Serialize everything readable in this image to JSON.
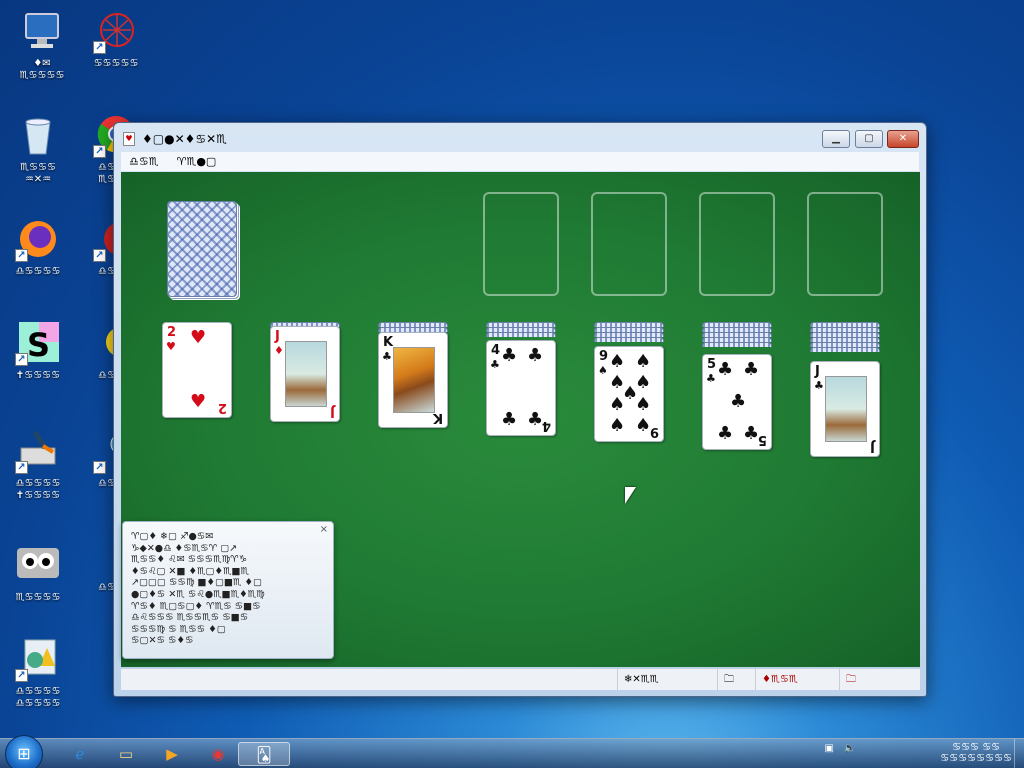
{
  "desktop": {
    "icons": [
      {
        "label": "♦✉\n♏♋♋♋♋",
        "icon": "computer-icon"
      },
      {
        "label": "♋♋♋♋♋",
        "icon": "network-icon"
      },
      {
        "label": "♏♋♋♋\n♒✕♒",
        "icon": "recycle-bin-icon"
      },
      {
        "label": "♎♋♋♋\n♏♋♋♋",
        "icon": "chrome-icon"
      },
      {
        "label": "♎♋♋♋♋",
        "icon": "firefox-icon"
      },
      {
        "label": "♎♋♋♋",
        "icon": "app-icon"
      },
      {
        "label": "✝♋♋♋♋",
        "icon": "s-app-icon"
      },
      {
        "label": "♎♋♋♋",
        "icon": "emoji-app-icon"
      },
      {
        "label": "♎♋♋♋♋\n✝♋♋♋♋",
        "icon": "cleaner-icon"
      },
      {
        "label": "♎♋♋♋",
        "icon": "globe-app-icon"
      },
      {
        "label": "♏♋♋♋♋",
        "icon": "eyes-app-icon"
      },
      {
        "label": "♎♋♋♋",
        "icon": "folder-icon"
      },
      {
        "label": "♎♋♋♋♋\n♎♋♋♋♋",
        "icon": "settings-app-icon"
      }
    ]
  },
  "window": {
    "title": "♦▢●✕♦♋✕♏",
    "controls": {
      "minimize": "▁",
      "maximize": "▢",
      "close": "✕"
    },
    "menu": [
      "♎♋♏",
      "♈♏●▢"
    ]
  },
  "game": {
    "tableau": [
      {
        "rank": "2",
        "suit": "♥",
        "color": "red"
      },
      {
        "rank": "J",
        "suit": "♦",
        "color": "red"
      },
      {
        "rank": "K",
        "suit": "♣",
        "color": "blk"
      },
      {
        "rank": "4",
        "suit": "♣",
        "color": "blk"
      },
      {
        "rank": "9",
        "suit": "♠",
        "color": "blk"
      },
      {
        "rank": "5",
        "suit": "♣",
        "color": "blk"
      },
      {
        "rank": "J",
        "suit": "♣",
        "color": "blk"
      }
    ]
  },
  "help_panel": {
    "close": "×",
    "text": "♈▢♦ ❄▢ ♐●♋✉\n♑◆✕●♎ ♦♋♏♋♈ ▢↗\n♏♋♋♦ ♌✉ ♋♋♋♏♍♈♑\n♦♋♌▢ ✕■ ♦♏▢♦♏■♏\n↗▢▢▢ ♋♋♍ ■♦▢■♏ ♦▢\n●▢♦♋ ✕♏ ♋♌●♏■♏♦♏♍\n♈♋♦ ♏▢♋▢♦ ♈♏♋ ♋■♋\n♎♌♋♋♋ ♏♋♋♏♋ ♋■♋\n♋♋♋♍ ♋ ♏♋♋ ♦▢\n♋▢✕♋ ♋♦♋"
  },
  "statusbar": {
    "score": "❄✕♏♏",
    "time": "🗀",
    "moves": "♦♏♋♏",
    "moves_icon": "🗀"
  },
  "taskbar": {
    "apps": [
      {
        "name": "ie",
        "glyph": "ℯ"
      },
      {
        "name": "explorer",
        "glyph": "▭"
      },
      {
        "name": "media",
        "glyph": "▶"
      },
      {
        "name": "chrome",
        "glyph": "◉"
      },
      {
        "name": "solitaire",
        "glyph": "🂡"
      }
    ],
    "clock_line1": "♋♋♋ ♋♋",
    "clock_line2": "♋♋♋♋♋♋♋♋"
  }
}
